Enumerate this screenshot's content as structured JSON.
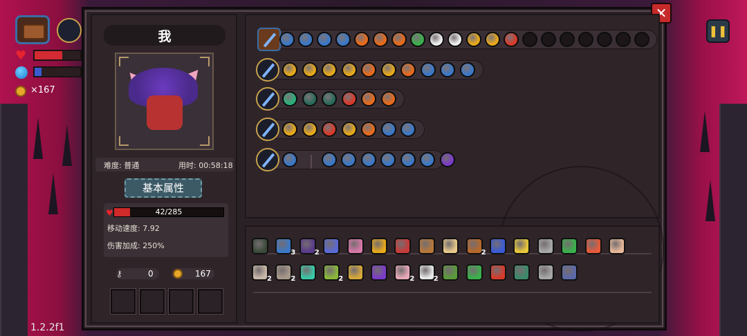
{
  "hud": {
    "coin_count": "×167",
    "version": "1.2.2f1",
    "pause_icon": "pause-icon",
    "hp_fill_fraction": 0.6,
    "mana_fill_fraction": 0.15
  },
  "panel": {
    "close_icon": "close-icon",
    "player_name": "我",
    "difficulty_label": "难度: 普通",
    "time_label": "用时: 00:58:18",
    "attributes_button": "基本属性",
    "hp_text": "42/285",
    "hp_fraction": 0.147,
    "move_speed_label": "移动速度: 7.92",
    "damage_bonus_label": "伤害加成: 250%",
    "key_count": "0",
    "coin_count": "167",
    "empty_slots": 4
  },
  "weapon_rows": [
    {
      "name": "chest-row",
      "icon_colors": [
        "#3a78c8",
        "#3a78c8",
        "#3a78c8",
        "#3a78c8",
        "#e86a1a",
        "#e86a1a",
        "#e86a1a",
        "#3ab04a",
        "#f0f0f0",
        "#f0f0f0",
        "#e8a81a",
        "#e8a81a",
        "#d83a2a"
      ],
      "empty_slots": 7
    },
    {
      "name": "sword-row",
      "icon_colors": [
        "#e8a81a",
        "#e8a81a",
        "#e8a81a",
        "#e8a81a",
        "#e86a1a",
        "#e8a81a",
        "#e86a1a",
        "#3a78c8",
        "#3a78c8",
        "#3a78c8"
      ]
    },
    {
      "name": "orb-row",
      "icon_colors": [
        "#2ab07a",
        "#2a6a5a",
        "#2a6a5a",
        "#d83a2a",
        "#e86a1a",
        "#e86a1a"
      ]
    },
    {
      "name": "staff-row",
      "icon_colors": [
        "#e8a81a",
        "#e8a81a",
        "#d83a2a",
        "#e8a81a",
        "#e86a1a",
        "#3a78c8",
        "#3a78c8"
      ]
    },
    {
      "name": "book-row",
      "icon_colors": [
        "#3a78c8",
        "#3a78c8",
        "#3a78c8",
        "#3a78c8",
        "#3a78c8",
        "#3a78c8",
        "#3a78c8",
        "#7a3ac8"
      ]
    }
  ],
  "items": {
    "row1": [
      {
        "name": "hat-icon",
        "color": "#3a4a3a",
        "count": ""
      },
      {
        "name": "magnifier-icon",
        "color": "#3a78c8",
        "count": "3"
      },
      {
        "name": "robe-icon",
        "color": "#5a3a8a",
        "count": "2"
      },
      {
        "name": "crystal-icon",
        "color": "#5a6ad8",
        "count": ""
      },
      {
        "name": "brain-icon",
        "color": "#d878a8",
        "count": ""
      },
      {
        "name": "gauntlet-icon",
        "color": "#e8a81a",
        "count": ""
      },
      {
        "name": "eye-icon",
        "color": "#c83a3a",
        "count": ""
      },
      {
        "name": "pickaxe-icon",
        "color": "#b8783a",
        "count": ""
      },
      {
        "name": "chicken-icon",
        "color": "#e8c88a",
        "count": ""
      },
      {
        "name": "barrel-icon",
        "color": "#b8682a",
        "count": "2"
      },
      {
        "name": "potion-icon",
        "color": "#3a5ad8",
        "count": ""
      },
      {
        "name": "gold-crystal-icon",
        "color": "#e8c83a",
        "count": ""
      },
      {
        "name": "horn-icon",
        "color": "#a8a8a8",
        "count": ""
      },
      {
        "name": "leaf-icon",
        "color": "#3ab04a",
        "count": ""
      },
      {
        "name": "heart-icon",
        "color": "#e85a3a",
        "count": ""
      },
      {
        "name": "egg-icon",
        "color": "#e8b898",
        "count": ""
      }
    ],
    "row2": [
      {
        "name": "bone-icon",
        "color": "#c8b8a8",
        "count": "2"
      },
      {
        "name": "tome-icon",
        "color": "#a89888",
        "count": "2"
      },
      {
        "name": "shell-icon",
        "color": "#3ac8a8",
        "count": ""
      },
      {
        "name": "snake-icon",
        "color": "#8ab83a",
        "count": "2"
      },
      {
        "name": "gem-icon",
        "color": "#d8a83a",
        "count": ""
      },
      {
        "name": "witch-hat-icon",
        "color": "#7a3ac8",
        "count": ""
      },
      {
        "name": "feather-icon",
        "color": "#e8a8b8",
        "count": "2"
      },
      {
        "name": "teeth-icon",
        "color": "#e8e8e8",
        "count": "2"
      },
      {
        "name": "frog-icon",
        "color": "#5a9a3a",
        "count": ""
      },
      {
        "name": "arrow-icon",
        "color": "#3ab04a",
        "count": ""
      },
      {
        "name": "demon-icon",
        "color": "#d83a2a",
        "count": ""
      },
      {
        "name": "belt-icon",
        "color": "#3a8a6a",
        "count": ""
      },
      {
        "name": "sword-icon",
        "color": "#a8a8a8",
        "count": ""
      },
      {
        "name": "boot-icon",
        "color": "#5a6aa8",
        "count": ""
      }
    ]
  }
}
